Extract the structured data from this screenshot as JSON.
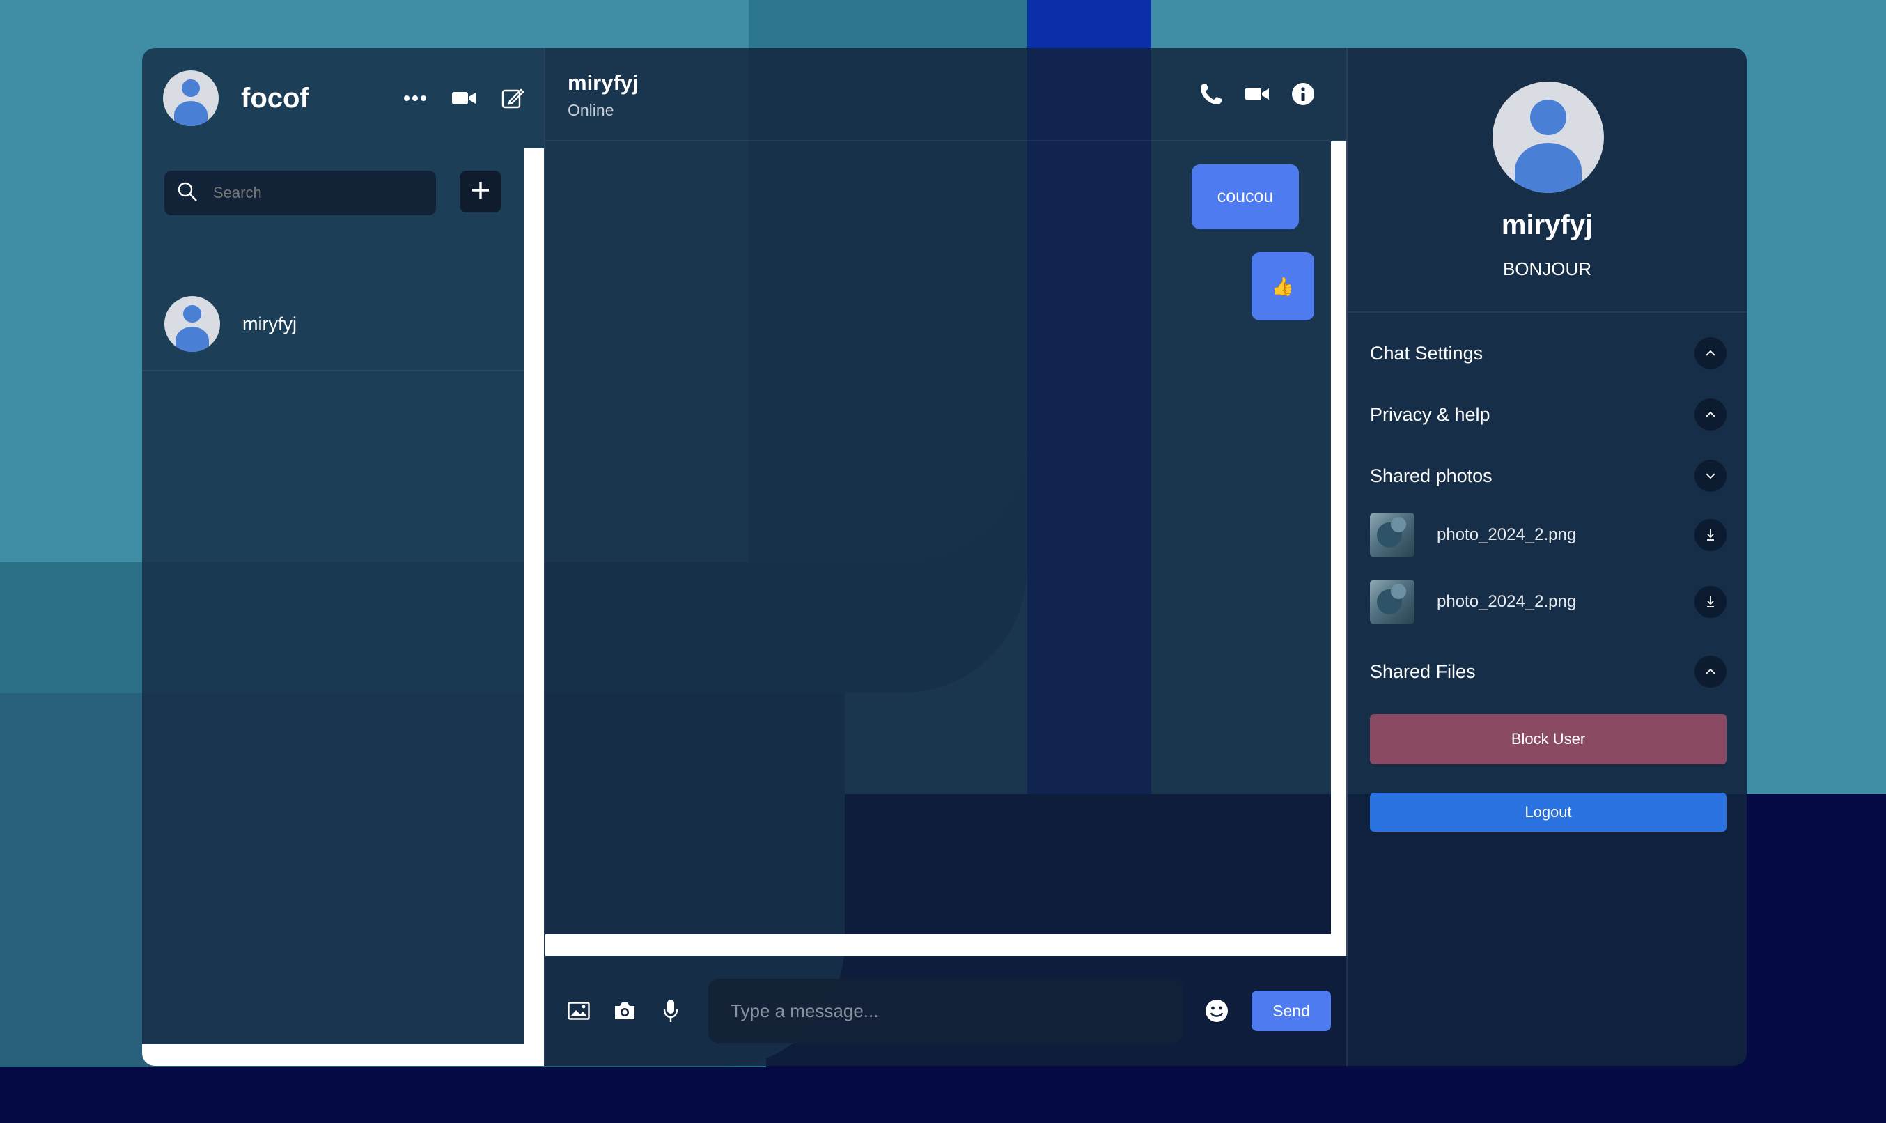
{
  "colors": {
    "accent": "#4e7cf0",
    "block_button": "#8a4a63",
    "logout_button": "#2a72e0",
    "background_top": "#3f8ea6",
    "background_bottom": "#050a45"
  },
  "sidebar": {
    "username": "focof",
    "header_icons": [
      "more-icon",
      "video-camera-icon",
      "compose-icon"
    ],
    "search": {
      "placeholder": "Search",
      "value": ""
    },
    "add_icon": "plus-icon",
    "contacts": [
      {
        "name": "miryfyj"
      }
    ]
  },
  "chat": {
    "contact_name": "miryfyj",
    "status": "Online",
    "header_icons": [
      "phone-icon",
      "video-camera-icon",
      "info-icon"
    ],
    "messages": [
      {
        "text": "coucou",
        "sender": "me"
      },
      {
        "text": "👍",
        "sender": "me"
      }
    ],
    "composer": {
      "placeholder": "Type a message...",
      "value": "",
      "icons": [
        "image-icon",
        "camera-icon",
        "microphone-icon",
        "emoji-icon"
      ],
      "send_label": "Send"
    }
  },
  "details": {
    "name": "miryfyj",
    "bio": "BONJOUR",
    "sections": [
      {
        "label": "Chat Settings",
        "state": "collapsed"
      },
      {
        "label": "Privacy & help",
        "state": "collapsed"
      },
      {
        "label": "Shared photos",
        "state": "expanded"
      },
      {
        "label": "Shared Files",
        "state": "collapsed"
      }
    ],
    "shared_photos": [
      {
        "name": "photo_2024_2.png"
      },
      {
        "name": "photo_2024_2.png"
      }
    ],
    "block_label": "Block User",
    "logout_label": "Logout"
  }
}
